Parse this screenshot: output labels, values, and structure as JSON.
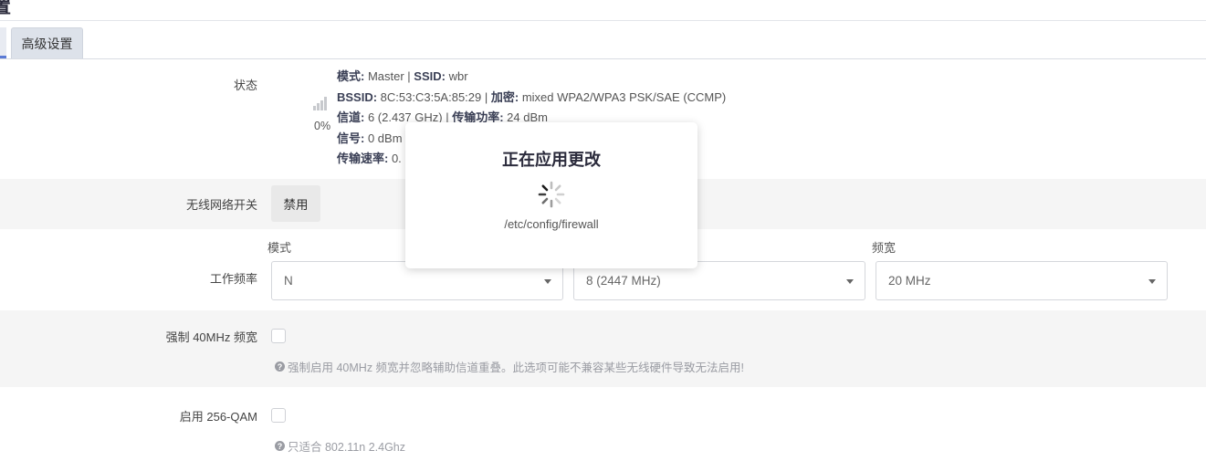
{
  "page": {
    "title_fragment": "置"
  },
  "tabs": {
    "advanced_label": "高级设置"
  },
  "status": {
    "label": "状态",
    "signal_percent": "0%",
    "lines": [
      [
        {
          "k": "模式:",
          "v": " Master | "
        },
        {
          "k": "SSID:",
          "v": " wbr"
        }
      ],
      [
        {
          "k": "BSSID:",
          "v": " 8C:53:C3:5A:85:29 | "
        },
        {
          "k": "加密:",
          "v": " mixed WPA2/WPA3 PSK/SAE (CCMP)"
        }
      ],
      [
        {
          "k": "信道:",
          "v": " 6 (2.437 GHz) | "
        },
        {
          "k": "传输功率:",
          "v": " 24 dBm"
        }
      ],
      [
        {
          "k": "信号:",
          "v": " 0 dBm"
        }
      ],
      [
        {
          "k": "传输速率:",
          "v": " 0."
        }
      ]
    ]
  },
  "wireless_switch": {
    "label": "无线网络开关",
    "button": "禁用"
  },
  "frequency": {
    "label": "工作频率",
    "mode_header": "模式",
    "mode_value": "N",
    "channel_value": "8 (2447 MHz)",
    "width_header": "频宽",
    "width_value": "20 MHz"
  },
  "force40": {
    "label": "强制 40MHz 频宽",
    "help": "强制启用 40MHz 频宽并忽略辅助信道重叠。此选项可能不兼容某些无线硬件导致无法启用!"
  },
  "qam256": {
    "label": "启用 256-QAM",
    "help": "只适合 802.11n 2.4Ghz"
  },
  "modal": {
    "title": "正在应用更改",
    "file": "/etc/config/firewall"
  }
}
